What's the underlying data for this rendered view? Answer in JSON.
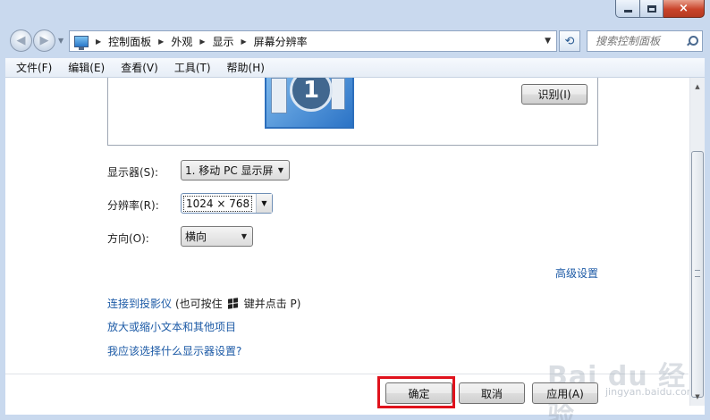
{
  "window": {
    "controls": {
      "minimize": "minimize",
      "maximize": "maximize",
      "close": "×"
    }
  },
  "nav": {
    "back_icon": "◀",
    "forward_icon": "▶",
    "breadcrumb": [
      "控制面板",
      "外观",
      "显示",
      "屏幕分辨率"
    ],
    "refresh_icon": "⟲",
    "search_placeholder": "搜索控制面板"
  },
  "menubar": {
    "items": [
      "文件(F)",
      "编辑(E)",
      "查看(V)",
      "工具(T)",
      "帮助(H)"
    ]
  },
  "preview": {
    "monitor_number": "1",
    "identify_label": "识别(I)"
  },
  "settings": {
    "display_label": "显示器(S):",
    "display_value": "1. 移动 PC 显示屏",
    "resolution_label": "分辨率(R):",
    "resolution_value": "1024 × 768",
    "orientation_label": "方向(O):",
    "orientation_value": "横向"
  },
  "links": {
    "advanced": "高级设置",
    "projector": "连接到投影仪",
    "projector_hint_pre": "(也可按住",
    "projector_hint_post": "键并点击 P)",
    "text_size": "放大或缩小文本和其他项目",
    "which_setting": "我应该选择什么显示器设置?"
  },
  "buttons": {
    "ok": "确定",
    "cancel": "取消",
    "apply": "应用(A)"
  },
  "watermark": {
    "main": "Bai du 经验",
    "sub": "jingyan.baidu.com"
  },
  "colors": {
    "link": "#1c5aa6",
    "highlight": "#e0121c",
    "window_frame": "#c9d9ee"
  }
}
